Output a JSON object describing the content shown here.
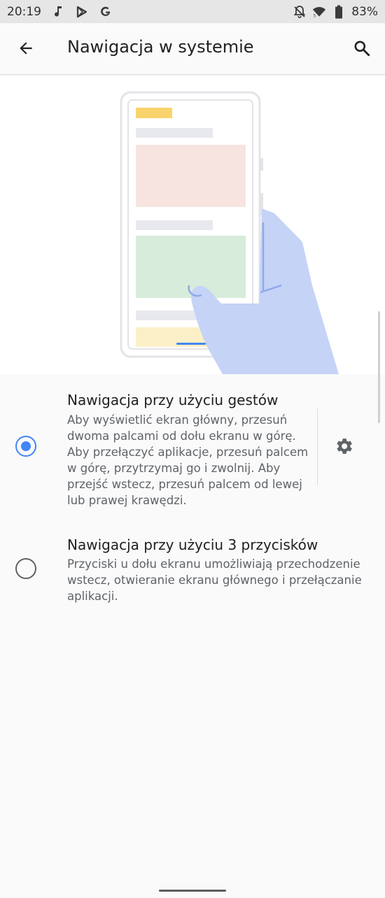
{
  "status_bar": {
    "time": "20:19",
    "left_icons": [
      "music-note-icon",
      "play-store-icon",
      "google-icon"
    ],
    "right_icons": [
      "notifications-off-icon",
      "wifi-icon",
      "battery-icon"
    ],
    "battery": "83%"
  },
  "app_bar": {
    "title": "Nawigacja w systemie",
    "back_icon": "arrow-back-icon",
    "search_icon": "search-icon"
  },
  "options": [
    {
      "title": "Nawigacja przy użyciu gestów",
      "summary_lines": [
        "Aby wyświetlić ekran główny, przesuń",
        "dwoma palcami od dołu ekranu w górę.",
        "Aby przełączyć aplikacje, przesuń palcem",
        "w górę, przytrzymaj go i zwolnij. Aby",
        "przejść wstecz, przesuń palcem od lewej",
        "lub prawej krawędzi."
      ],
      "selected": true,
      "settings_icon": "gear-icon"
    },
    {
      "title": "Nawigacja przy użyciu 3 przycisków",
      "summary_lines": [
        "Przyciski u dołu ekranu umożliwiają przechodzenie",
        "wstecz, otwieranie ekranu głównego i przełączanie",
        "aplikacji."
      ],
      "selected": false
    }
  ],
  "colors": {
    "accent": "#4285f4",
    "hand": "#c5d3f6",
    "card_red": "#f7e4e1",
    "card_green": "#d7ecda",
    "card_yellow": "#fcf0c8",
    "title_bar_yellow": "#f9d36c"
  }
}
